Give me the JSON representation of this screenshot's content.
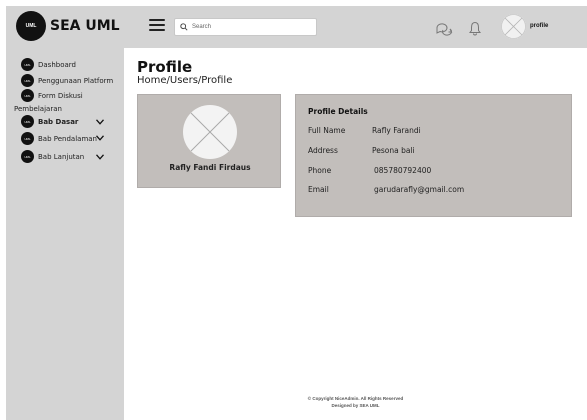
{
  "brand": {
    "logo_text": "UML",
    "name": "SEA UML"
  },
  "header": {
    "search_placeholder": "Search",
    "profile_label": "profile",
    "icons": [
      "menu-icon",
      "search-icon",
      "chat-icon",
      "bell-icon",
      "avatar"
    ]
  },
  "sidebar": {
    "badge_text": "UML",
    "items_top": [
      {
        "label": "Dashboard"
      },
      {
        "label": "Penggunaan Platform"
      },
      {
        "label": "Form Diskusi"
      }
    ],
    "section_label": "Pembelajaran",
    "items_sub": [
      {
        "label": "Bab Dasar"
      },
      {
        "label": "Bab Pendalaman"
      },
      {
        "label": "Bab Lanjutan"
      }
    ]
  },
  "page": {
    "title": "Profile",
    "breadcrumb": "Home/Users/Profile"
  },
  "profile_card": {
    "name": "Rafly Fandi Firdaus"
  },
  "details": {
    "title": "Profile Details",
    "rows": [
      {
        "label": "Full Name",
        "value": "Rafly Farandi"
      },
      {
        "label": "Address",
        "value": "Pesona bali"
      },
      {
        "label": "Phone",
        "value": "085780792400"
      },
      {
        "label": "Email",
        "value": "garudarafly@gmail.com"
      }
    ]
  },
  "footer": {
    "copyright": "© Copyright NiceAdmin. All Rights Reserved",
    "designed_by": "Designed by SEA UML"
  },
  "colors": {
    "header_bg": "#d4d4d4",
    "sidebar_bg": "#d4d4d4",
    "card_bg": "#c2bebb",
    "badge_bg": "#111111"
  }
}
